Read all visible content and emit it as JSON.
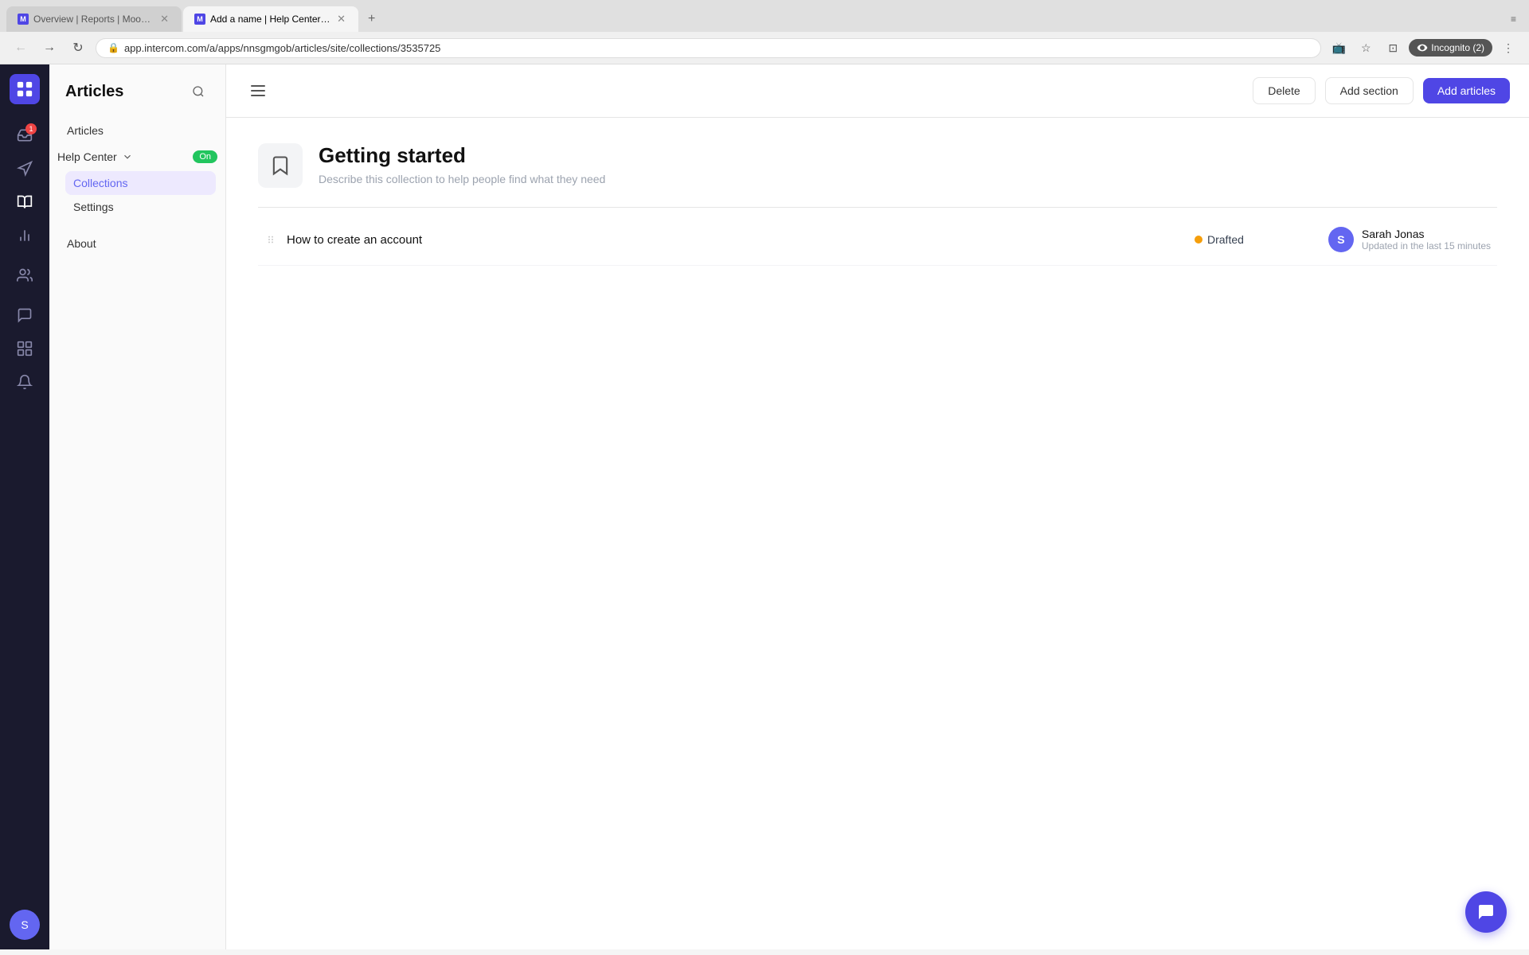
{
  "browser": {
    "tabs": [
      {
        "id": "tab1",
        "title": "Overview | Reports | Moodjoy",
        "favicon_color": "#4f46e5",
        "favicon_letter": "M",
        "active": false
      },
      {
        "id": "tab2",
        "title": "Add a name | Help Center | Mo...",
        "favicon_color": "#4f46e5",
        "favicon_letter": "M",
        "active": true
      }
    ],
    "new_tab_label": "+",
    "overflow_label": "≡",
    "url": "app.intercom.com/a/apps/nnsgmgob/articles/site/collections/3535725",
    "incognito_label": "Incognito (2)"
  },
  "sidebar": {
    "title": "Articles",
    "nav_items": [
      {
        "id": "articles",
        "label": "Articles"
      }
    ],
    "help_center": {
      "label": "Help Center",
      "status": "On"
    },
    "sub_items": [
      {
        "id": "collections",
        "label": "Collections",
        "active": true
      },
      {
        "id": "settings",
        "label": "Settings"
      }
    ],
    "about": {
      "label": "About"
    }
  },
  "toolbar": {
    "delete_label": "Delete",
    "add_section_label": "Add section",
    "add_articles_label": "Add articles"
  },
  "collection": {
    "title": "Getting started",
    "description": "Describe this collection to help people find what they need"
  },
  "articles": [
    {
      "id": "art1",
      "title": "How to create an account",
      "status": "Drafted",
      "status_color": "#f59e0b",
      "author_name": "Sarah Jonas",
      "author_initial": "S",
      "updated": "Updated in the last 15 minutes"
    }
  ]
}
